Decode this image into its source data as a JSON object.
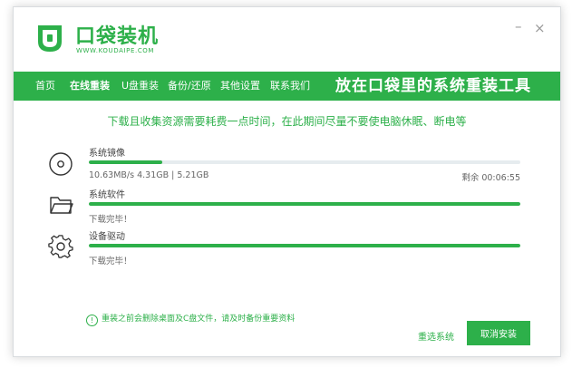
{
  "brand": {
    "name": "口袋装机",
    "domain": "WWW.KOUDAIPE.COM",
    "color": "#2db04a"
  },
  "window_controls": {
    "minimize": "–",
    "close": "×"
  },
  "nav": {
    "items": [
      "首页",
      "在线重装",
      "U盘重装",
      "备份/还原",
      "其他设置",
      "联系我们"
    ],
    "active": "在线重装",
    "slogan": "放在口袋里的系统重装工具"
  },
  "notice": "下载且收集资源需要耗费一点时间，在此期间尽量不要使电脑休眠、断电等",
  "downloads": [
    {
      "icon": "disc-icon",
      "title": "系统镜像",
      "progress": 0.17,
      "status_left": "10.63MB/s 4.31GB | 5.21GB",
      "status_right": "剩余 00:06:55"
    },
    {
      "icon": "folder-icon",
      "title": "系统软件",
      "progress": 1.0,
      "status_left": "下载完毕！",
      "status_right": ""
    },
    {
      "icon": "gear-icon",
      "title": "设备驱动",
      "progress": 1.0,
      "status_left": "下载完毕！",
      "status_right": ""
    }
  ],
  "footer": {
    "tip_icon": "info-icon",
    "tip": "重装之前会删除桌面及C盘文件，请及时备份重要资料",
    "reselect_label": "重选系统",
    "cancel_label": "取消安装"
  }
}
